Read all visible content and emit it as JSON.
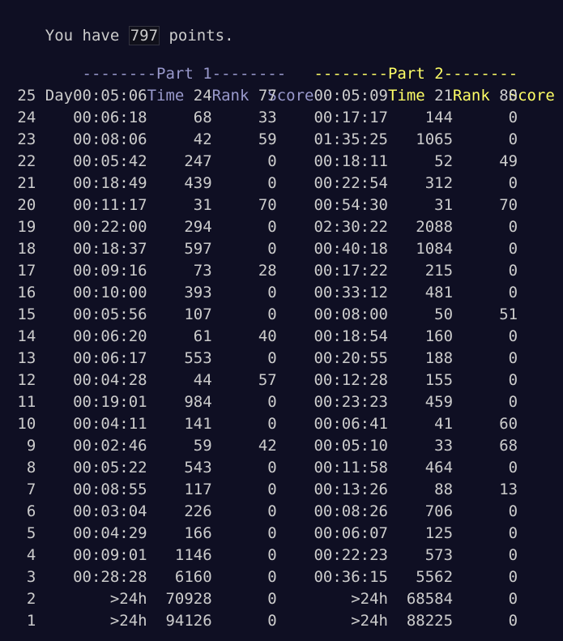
{
  "header": {
    "prefix": "You have ",
    "points": "797",
    "suffix": " points."
  },
  "part_titles": {
    "part1": "--------Part 1--------",
    "part2": "--------Part 2--------"
  },
  "columns": {
    "day": "Day",
    "time": "Time",
    "rank": "Rank",
    "score": "Score"
  },
  "colors": {
    "background": "#0f0f23",
    "text": "#cccccc",
    "part1": "#9999cc",
    "part2": "#ffff66"
  },
  "rows": [
    {
      "day": "25",
      "p1_time": "00:05:06",
      "p1_rank": "24",
      "p1_score": "77",
      "p2_time": "00:05:09",
      "p2_rank": "21",
      "p2_score": "80"
    },
    {
      "day": "24",
      "p1_time": "00:06:18",
      "p1_rank": "68",
      "p1_score": "33",
      "p2_time": "00:17:17",
      "p2_rank": "144",
      "p2_score": "0"
    },
    {
      "day": "23",
      "p1_time": "00:08:06",
      "p1_rank": "42",
      "p1_score": "59",
      "p2_time": "01:35:25",
      "p2_rank": "1065",
      "p2_score": "0"
    },
    {
      "day": "22",
      "p1_time": "00:05:42",
      "p1_rank": "247",
      "p1_score": "0",
      "p2_time": "00:18:11",
      "p2_rank": "52",
      "p2_score": "49"
    },
    {
      "day": "21",
      "p1_time": "00:18:49",
      "p1_rank": "439",
      "p1_score": "0",
      "p2_time": "00:22:54",
      "p2_rank": "312",
      "p2_score": "0"
    },
    {
      "day": "20",
      "p1_time": "00:11:17",
      "p1_rank": "31",
      "p1_score": "70",
      "p2_time": "00:54:30",
      "p2_rank": "31",
      "p2_score": "70"
    },
    {
      "day": "19",
      "p1_time": "00:22:00",
      "p1_rank": "294",
      "p1_score": "0",
      "p2_time": "02:30:22",
      "p2_rank": "2088",
      "p2_score": "0"
    },
    {
      "day": "18",
      "p1_time": "00:18:37",
      "p1_rank": "597",
      "p1_score": "0",
      "p2_time": "00:40:18",
      "p2_rank": "1084",
      "p2_score": "0"
    },
    {
      "day": "17",
      "p1_time": "00:09:16",
      "p1_rank": "73",
      "p1_score": "28",
      "p2_time": "00:17:22",
      "p2_rank": "215",
      "p2_score": "0"
    },
    {
      "day": "16",
      "p1_time": "00:10:00",
      "p1_rank": "393",
      "p1_score": "0",
      "p2_time": "00:33:12",
      "p2_rank": "481",
      "p2_score": "0"
    },
    {
      "day": "15",
      "p1_time": "00:05:56",
      "p1_rank": "107",
      "p1_score": "0",
      "p2_time": "00:08:00",
      "p2_rank": "50",
      "p2_score": "51"
    },
    {
      "day": "14",
      "p1_time": "00:06:20",
      "p1_rank": "61",
      "p1_score": "40",
      "p2_time": "00:18:54",
      "p2_rank": "160",
      "p2_score": "0"
    },
    {
      "day": "13",
      "p1_time": "00:06:17",
      "p1_rank": "553",
      "p1_score": "0",
      "p2_time": "00:20:55",
      "p2_rank": "188",
      "p2_score": "0"
    },
    {
      "day": "12",
      "p1_time": "00:04:28",
      "p1_rank": "44",
      "p1_score": "57",
      "p2_time": "00:12:28",
      "p2_rank": "155",
      "p2_score": "0"
    },
    {
      "day": "11",
      "p1_time": "00:19:01",
      "p1_rank": "984",
      "p1_score": "0",
      "p2_time": "00:23:23",
      "p2_rank": "459",
      "p2_score": "0"
    },
    {
      "day": "10",
      "p1_time": "00:04:11",
      "p1_rank": "141",
      "p1_score": "0",
      "p2_time": "00:06:41",
      "p2_rank": "41",
      "p2_score": "60"
    },
    {
      "day": "9",
      "p1_time": "00:02:46",
      "p1_rank": "59",
      "p1_score": "42",
      "p2_time": "00:05:10",
      "p2_rank": "33",
      "p2_score": "68"
    },
    {
      "day": "8",
      "p1_time": "00:05:22",
      "p1_rank": "543",
      "p1_score": "0",
      "p2_time": "00:11:58",
      "p2_rank": "464",
      "p2_score": "0"
    },
    {
      "day": "7",
      "p1_time": "00:08:55",
      "p1_rank": "117",
      "p1_score": "0",
      "p2_time": "00:13:26",
      "p2_rank": "88",
      "p2_score": "13"
    },
    {
      "day": "6",
      "p1_time": "00:03:04",
      "p1_rank": "226",
      "p1_score": "0",
      "p2_time": "00:08:26",
      "p2_rank": "706",
      "p2_score": "0"
    },
    {
      "day": "5",
      "p1_time": "00:04:29",
      "p1_rank": "166",
      "p1_score": "0",
      "p2_time": "00:06:07",
      "p2_rank": "125",
      "p2_score": "0"
    },
    {
      "day": "4",
      "p1_time": "00:09:01",
      "p1_rank": "1146",
      "p1_score": "0",
      "p2_time": "00:22:23",
      "p2_rank": "573",
      "p2_score": "0"
    },
    {
      "day": "3",
      "p1_time": "00:28:28",
      "p1_rank": "6160",
      "p1_score": "0",
      "p2_time": "00:36:15",
      "p2_rank": "5562",
      "p2_score": "0"
    },
    {
      "day": "2",
      "p1_time": ">24h",
      "p1_rank": "70928",
      "p1_score": "0",
      "p2_time": ">24h",
      "p2_rank": "68584",
      "p2_score": "0"
    },
    {
      "day": "1",
      "p1_time": ">24h",
      "p1_rank": "94126",
      "p1_score": "0",
      "p2_time": ">24h",
      "p2_rank": "88225",
      "p2_score": "0"
    }
  ]
}
